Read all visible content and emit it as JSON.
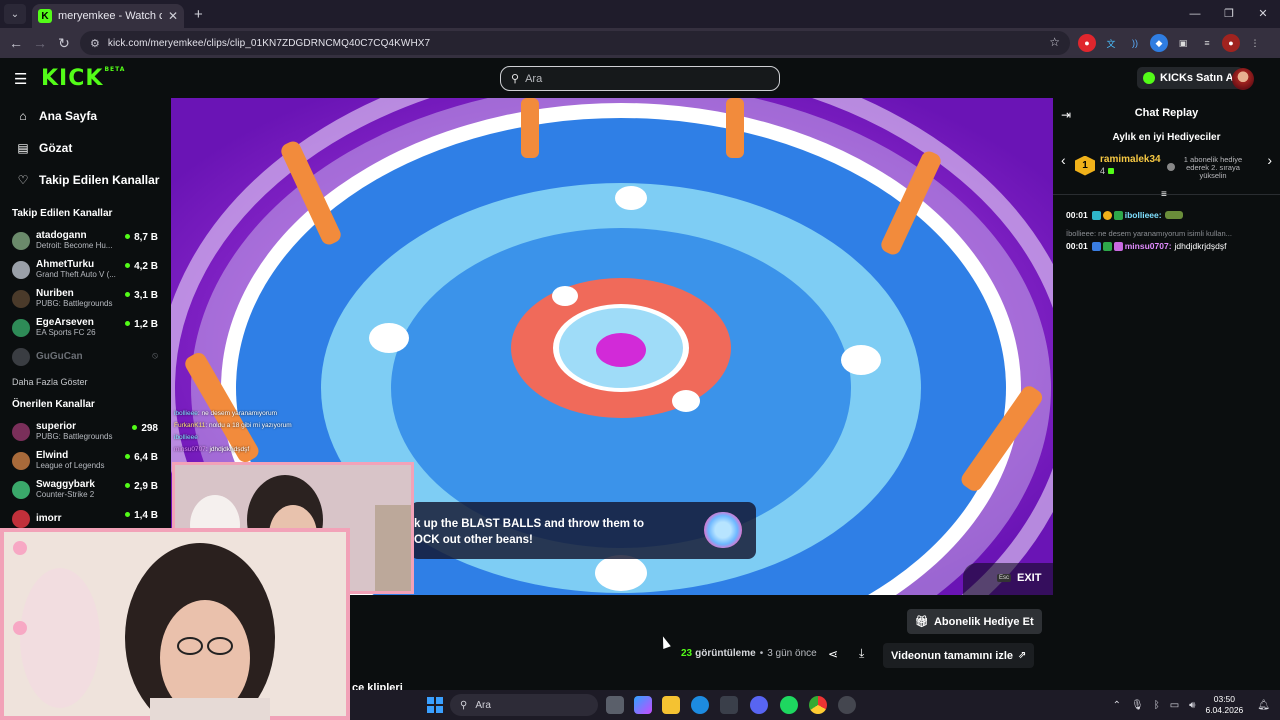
{
  "browser": {
    "tab_title": "meryemkee - Watch clips on Kick",
    "tab_favicon": "K",
    "url": "kick.com/meryemkee/clips/clip_01KN7ZDGDRNCMQ40C7CQ4KWHX7",
    "accent": "#53fc18"
  },
  "kick": {
    "logo": "KICK",
    "logo_badge": "BETA",
    "search_placeholder": "Ara",
    "kicks_button": "KICKs Satın Al"
  },
  "sidebar": {
    "nav": [
      {
        "label": "Ana Sayfa",
        "icon": "home-icon"
      },
      {
        "label": "Gözat",
        "icon": "browse-icon"
      },
      {
        "label": "Takip Edilen Kanallar",
        "icon": "heart-icon"
      }
    ],
    "followed_title": "Takip Edilen Kanallar",
    "followed": [
      {
        "name": "atadogann",
        "game": "Detroit: Become Hu...",
        "viewers": "8,7 B",
        "color": "#6b8a6b"
      },
      {
        "name": "AhmetTurku",
        "game": "Grand Theft Auto V (...",
        "viewers": "4,2 B",
        "color": "#9aa0a8"
      },
      {
        "name": "Nuriben",
        "game": "PUBG: Battlegrounds",
        "viewers": "3,1 B",
        "color": "#4a3a2a"
      },
      {
        "name": "EgeArseven",
        "game": "EA Sports FC 26",
        "viewers": "1,2 B",
        "color": "#2e8b57"
      }
    ],
    "offline": {
      "name": "GuGuCan"
    },
    "show_more": "Daha Fazla Göster",
    "recommended_title": "Önerilen Kanallar",
    "recommended": [
      {
        "name": "superior",
        "game": "PUBG: Battlegrounds",
        "viewers": "298",
        "color": "#7a2f5a"
      },
      {
        "name": "Elwind",
        "game": "League of Legends",
        "viewers": "6,4 B",
        "color": "#a86a3a"
      },
      {
        "name": "Swaggybark",
        "game": "Counter-Strike 2",
        "viewers": "2,9 B",
        "color": "#3aa86a"
      },
      {
        "name": "imorr",
        "game": "",
        "viewers": "1,4 B",
        "color": "#c0303a"
      }
    ]
  },
  "video": {
    "overlay_line1": "k up the BLAST BALLS and throw them to",
    "overlay_line2": "OCK out other beans!",
    "exit_key": "Esc",
    "exit_label": "EXIT",
    "game_chat": [
      {
        "user": "ibollieee",
        "text": "ne desem yaranamıyorum"
      },
      {
        "user": "FurkanK11",
        "text": "noldu a 18 gibi mi yazıyorum"
      },
      {
        "user": "ibollieee",
        "text": ""
      },
      {
        "user": "minsu0707",
        "text": "jdhdjdkrjdşdşf"
      }
    ]
  },
  "below_video": {
    "gift_button": "Abonelik Hediye Et",
    "views_count": "23",
    "views_label": "görüntüleme",
    "separator": "•",
    "time_ago": "3 gün önce",
    "full_video": "Videonun tamamını izle",
    "clips_title": "ce klipleri"
  },
  "chat": {
    "title": "Chat Replay",
    "subtitle": "Aylık en iyi Hediyeciler",
    "top_gifter": {
      "rank": "1",
      "name": "ramimalek34",
      "count": "4"
    },
    "next_gift_text": "1 abonelik hediye ederek 2. sıraya yükselin",
    "messages": [
      {
        "time": "00:01",
        "user": "ibollieee:",
        "text": "",
        "user_color": "#7fe0ff"
      },
      {
        "time": "00:01",
        "user": "minsu0707:",
        "text": "jdhdjdkrjdşdşf",
        "user_color": "#e28cff"
      }
    ],
    "reply_preview": "İbollieee: ne desem yaranamıyorum isimli kullan..."
  },
  "taskbar": {
    "search": "Ara",
    "time": "03:50",
    "date": "6.04.2026"
  }
}
